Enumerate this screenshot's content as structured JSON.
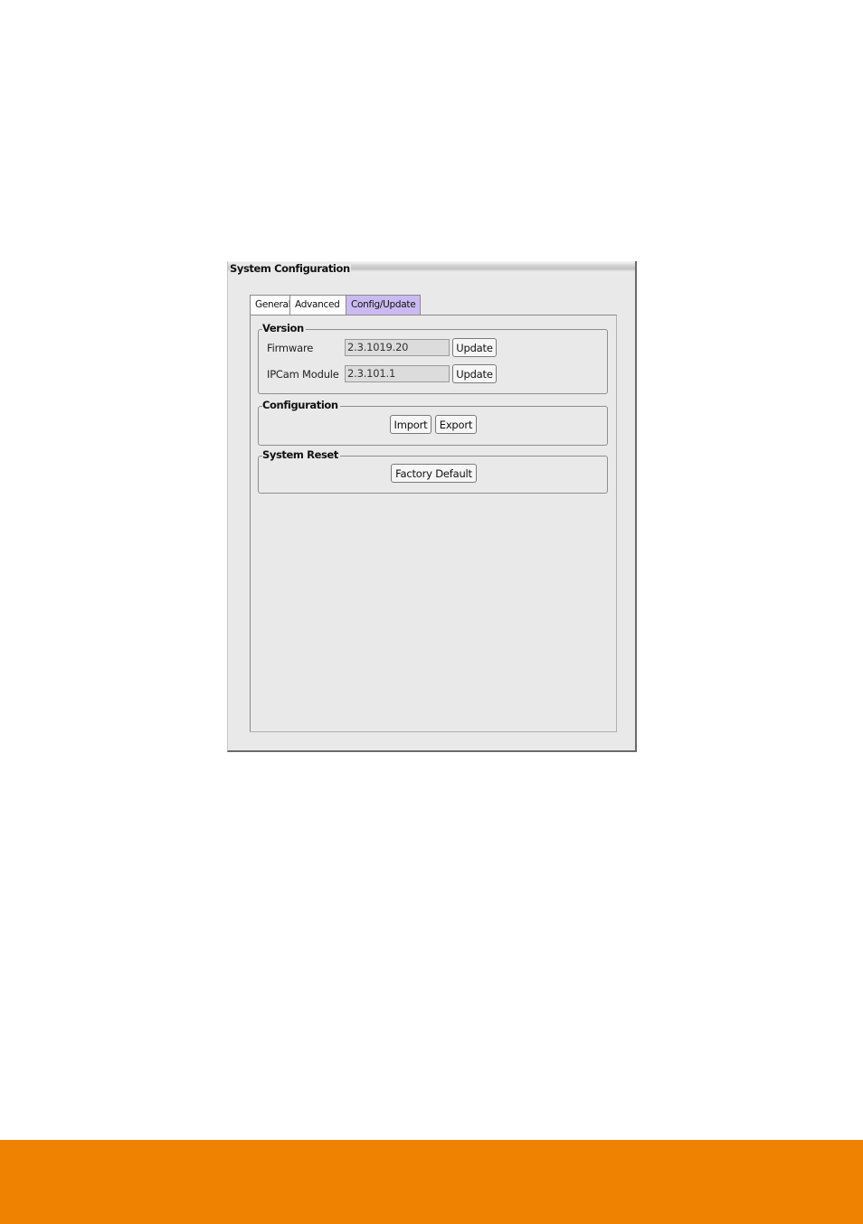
{
  "window": {
    "title": "System Configuration"
  },
  "tabs": [
    {
      "label": "General",
      "active": false
    },
    {
      "label": "Advanced",
      "active": false
    },
    {
      "label": "Config/Update",
      "active": true
    }
  ],
  "version_group": {
    "title": "Version",
    "rows": [
      {
        "label": "Firmware",
        "value": "2.3.1019.20",
        "button": "Update"
      },
      {
        "label": "IPCam Module",
        "value": "2.3.101.1",
        "button": "Update"
      }
    ]
  },
  "configuration_group": {
    "title": "Configuration",
    "import_label": "Import",
    "export_label": "Export"
  },
  "system_reset_group": {
    "title": "System Reset",
    "factory_default_label": "Factory Default"
  },
  "colors": {
    "active_tab": "#cbbaf2",
    "footer_bar": "#ef8200",
    "panel_bg": "#e9e9e9"
  }
}
